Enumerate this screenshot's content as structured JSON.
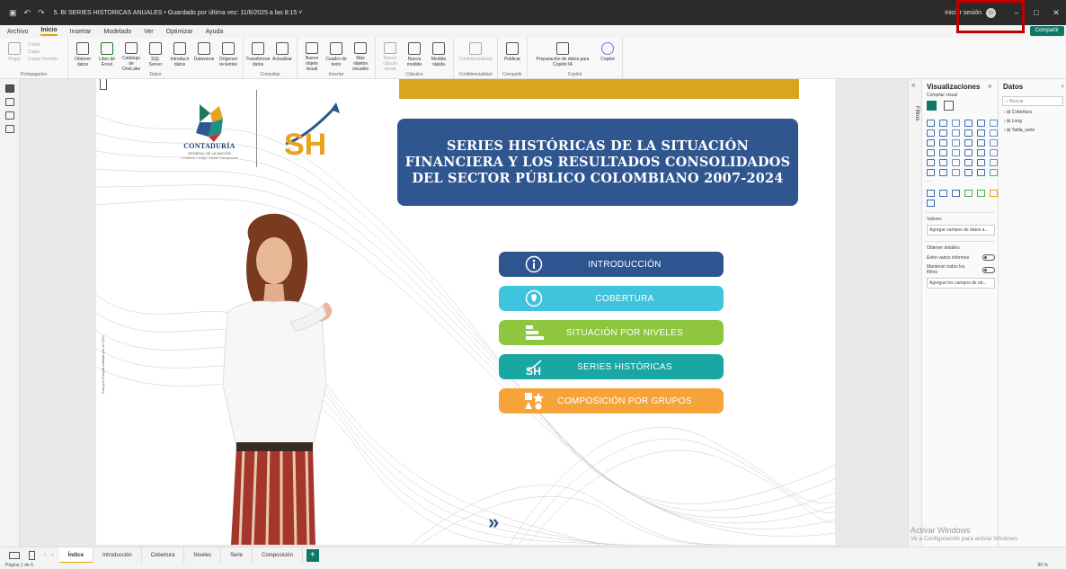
{
  "titlebar": {
    "title": "5. BI SERIES HISTORICAS ANUALES • Guardado por última vez: 11/6/2025 a las 8:15 ˅",
    "signin": "Iniciar sesión",
    "share": "Compartir"
  },
  "menu": [
    "Archivo",
    "Inicio",
    "Insertar",
    "Modelado",
    "Ver",
    "Optimizar",
    "Ayuda"
  ],
  "ribbon": {
    "clipboard": {
      "paste": "Pegar",
      "cut": "Cortar",
      "copy": "Copia",
      "format": "Copiar formato",
      "label": "Portapapeles"
    },
    "data": {
      "label": "Datos",
      "buttons": [
        "Obtener datos",
        "Libro de Excel",
        "Catálogo de OneLake",
        "SQL Server",
        "Introducir datos",
        "Dataverse",
        "Orígenes recientes"
      ]
    },
    "queries": {
      "label": "Consultas",
      "buttons": [
        "Transformar datos",
        "Actualizar"
      ]
    },
    "insert": {
      "label": "Insertar",
      "buttons": [
        "Nuevo objeto visual",
        "Cuadro de texto",
        "Más objetos visuales"
      ]
    },
    "calc": {
      "label": "Cálculos",
      "buttons": [
        "Nuevo cálculo visual",
        "Nueva medida",
        "Medida rápida"
      ]
    },
    "sensitivity": {
      "label": "Confidencialidad",
      "buttons": [
        "Confidencialidad"
      ]
    },
    "share": {
      "label": "Compartir",
      "buttons": [
        "Publicar"
      ]
    },
    "copilot": {
      "label": "Copilot",
      "buttons": [
        "Preparación de datos para Copilot IA",
        "Copilot"
      ]
    }
  },
  "report": {
    "title": "SERIES HISTÓRICAS DE LA SITUACIÓN FINANCIERA Y LOS RESULTADOS CONSOLIDADOS DEL SECTOR PÚBLICO COLOMBIANO 2007-2024",
    "logo_main": "CONTADURÍA",
    "logo_sub": "GENERAL DE LA NACIÓN",
    "logo_tag": "Contamos Contigo, Estado Transparente",
    "sh_text": "SH",
    "photo_credit": "Foto por Freepik editada por la CGN",
    "buttons": [
      {
        "label": "INTRODUCCIÓN",
        "color": "#2e5590"
      },
      {
        "label": "COBERTURA",
        "color": "#40c3dd"
      },
      {
        "label": "SITUACIÓN POR NIVELES",
        "color": "#8ec63f"
      },
      {
        "label": "SERIES HISTÓRICAS",
        "color": "#1aa6a3"
      },
      {
        "label": "COMPOSICIÓN POR GRUPOS",
        "color": "#f6a33a"
      }
    ],
    "next_arrow": "»"
  },
  "panes": {
    "filters": "Filtros",
    "viz_title": "Visualizaciones",
    "viz_sub": "Compilar visual",
    "values": "Valores",
    "add_fields": "Agregar campos de datos a...",
    "drill": "Obtener detalles",
    "cross_report": "Entre varios informes",
    "keep_filters": "Mantener todos los filtros",
    "add_drill_fields": "Agregue los campos de ob...",
    "data_title": "Datos",
    "search_placeholder": "Buscar",
    "tables": [
      "Cobertura",
      "Long",
      "Tabla_serie"
    ]
  },
  "tabs": [
    "Índice",
    "Introducción",
    "Cobertura",
    "Niveles",
    "Serie",
    "Composición"
  ],
  "status": {
    "page": "Página 1 de 6",
    "zoom": "85 %",
    "watermark_title": "Activar Windows",
    "watermark_sub": "Ve a Configuración para activar Windows."
  }
}
